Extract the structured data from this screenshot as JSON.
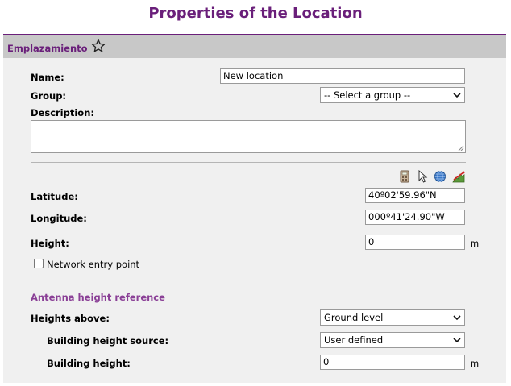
{
  "page": {
    "title": "Properties of the Location"
  },
  "header": {
    "label": "Emplazamiento"
  },
  "form": {
    "name": {
      "label": "Name:",
      "value": "New location"
    },
    "group": {
      "label": "Group:",
      "selected": "-- Select a group --"
    },
    "description": {
      "label": "Description:",
      "value": ""
    },
    "latitude": {
      "label": "Latitude:",
      "value": "40º02'59.96\"N"
    },
    "longitude": {
      "label": "Longitude:",
      "value": "000º41'24.90\"W"
    },
    "height": {
      "label": "Height:",
      "value": "0",
      "unit": "m"
    },
    "network_entry": {
      "label": "Network entry point",
      "checked": false
    }
  },
  "toolbar": {
    "icons": [
      "calculator-icon",
      "pointer-icon",
      "globe-icon",
      "terrain-profile-icon"
    ]
  },
  "antenna": {
    "section_title": "Antenna height reference",
    "heights_above": {
      "label": "Heights above:",
      "selected": "Ground level"
    },
    "building_source": {
      "label": "Building height source:",
      "selected": "User defined"
    },
    "building_height": {
      "label": "Building height:",
      "value": "0",
      "unit": "m"
    }
  },
  "colors": {
    "accent": "#6a1f7a",
    "section": "#8a3f96",
    "panel": "#f0f0f0",
    "header_bar": "#c8c8c8"
  }
}
